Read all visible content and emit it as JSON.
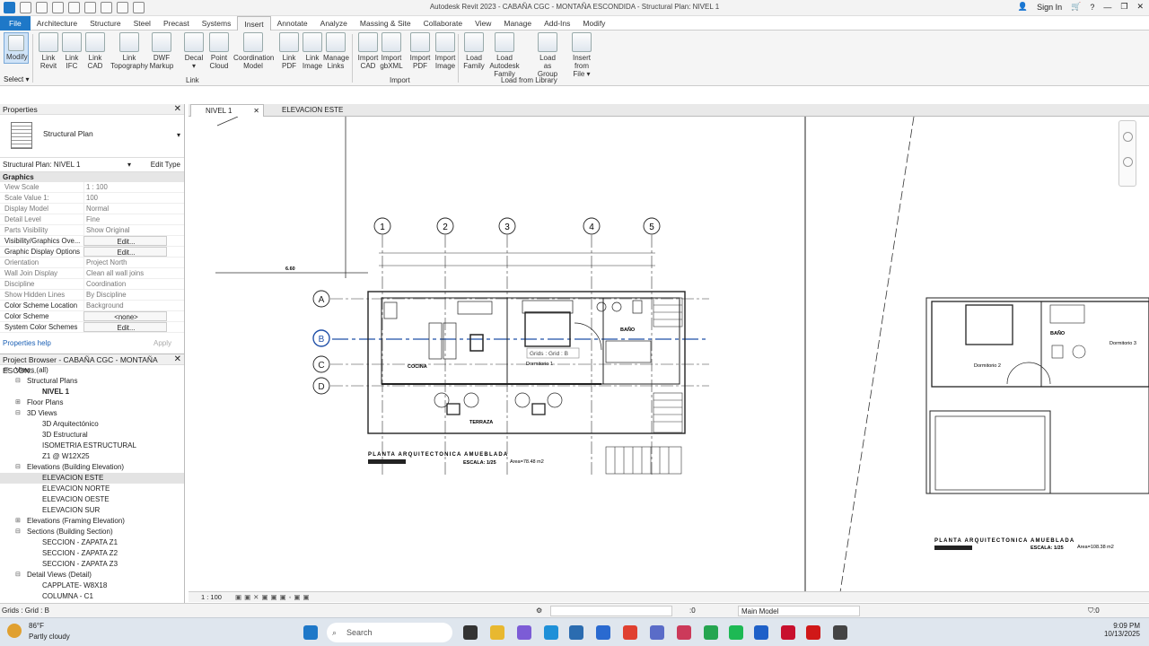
{
  "title_bar": {
    "title": "Autodesk Revit 2023 - CABAÑA CGC - MONTAÑA ESCONDIDA - Structural Plan: NIVEL 1",
    "sign_in": "Sign In"
  },
  "ribbon_tabs": [
    "File",
    "Architecture",
    "Structure",
    "Steel",
    "Precast",
    "Systems",
    "Insert",
    "Annotate",
    "Analyze",
    "Massing & Site",
    "Collaborate",
    "View",
    "Manage",
    "Add-Ins",
    "Modify"
  ],
  "ribbon": {
    "modify": "Modify",
    "select": "Select ▾",
    "buttons": [
      {
        "l1": "Link",
        "l2": "Revit"
      },
      {
        "l1": "Link",
        "l2": "IFC"
      },
      {
        "l1": "Link",
        "l2": "CAD"
      },
      {
        "l1": "Link",
        "l2": "Topography"
      },
      {
        "l1": "DWF",
        "l2": "Markup"
      },
      {
        "l1": "Decal",
        "l2": "▾"
      },
      {
        "l1": "Point",
        "l2": "Cloud"
      },
      {
        "l1": "Coordination",
        "l2": "Model"
      },
      {
        "l1": "Link",
        "l2": "PDF"
      },
      {
        "l1": "Link",
        "l2": "Image"
      },
      {
        "l1": "Manage",
        "l2": "Links"
      },
      {
        "l1": "Import",
        "l2": "CAD"
      },
      {
        "l1": "Import",
        "l2": "gbXML"
      },
      {
        "l1": "Import",
        "l2": "PDF"
      },
      {
        "l1": "Import",
        "l2": "Image"
      },
      {
        "l1": "Load",
        "l2": "Family"
      },
      {
        "l1": "Load Autodesk",
        "l2": "Family"
      },
      {
        "l1": "Load as",
        "l2": "Group"
      },
      {
        "l1": "Insert",
        "l2": "from File ▾"
      }
    ],
    "panels": [
      "Link",
      "Import",
      "Load from Library"
    ]
  },
  "properties": {
    "header": "Properties",
    "type_name": "Structural Plan",
    "instance": "Structural Plan: NIVEL 1",
    "edit_type": "Edit Type",
    "group": "Graphics",
    "rows": [
      {
        "k": "View Scale",
        "v": "1 : 100",
        "btn": false,
        "dark": false
      },
      {
        "k": "Scale Value    1:",
        "v": "100",
        "btn": false,
        "dark": false
      },
      {
        "k": "Display Model",
        "v": "Normal",
        "btn": false,
        "dark": false
      },
      {
        "k": "Detail Level",
        "v": "Fine",
        "btn": false,
        "dark": false
      },
      {
        "k": "Parts Visibility",
        "v": "Show Original",
        "btn": false,
        "dark": false
      },
      {
        "k": "Visibility/Graphics Ove...",
        "v": "Edit...",
        "btn": true,
        "dark": true
      },
      {
        "k": "Graphic Display Options",
        "v": "Edit...",
        "btn": true,
        "dark": true
      },
      {
        "k": "Orientation",
        "v": "Project North",
        "btn": false,
        "dark": false
      },
      {
        "k": "Wall Join Display",
        "v": "Clean all wall joins",
        "btn": false,
        "dark": false
      },
      {
        "k": "Discipline",
        "v": "Coordination",
        "btn": false,
        "dark": false
      },
      {
        "k": "Show Hidden Lines",
        "v": "By Discipline",
        "btn": false,
        "dark": false
      },
      {
        "k": "Color Scheme Location",
        "v": "Background",
        "btn": false,
        "dark": true
      },
      {
        "k": "Color Scheme",
        "v": "<none>",
        "btn": true,
        "dark": true
      },
      {
        "k": "System Color Schemes",
        "v": "Edit...",
        "btn": true,
        "dark": true
      }
    ],
    "help": "Properties help",
    "apply": "Apply"
  },
  "browser": {
    "header": "Project Browser - CABAÑA CGC - MONTAÑA ESCON...",
    "items": [
      {
        "t": "⊟",
        "label": "Views (all)",
        "lvl": 0,
        "sel": false,
        "bold": false
      },
      {
        "t": "⊟",
        "label": "Structural Plans",
        "lvl": 1,
        "sel": false,
        "bold": false
      },
      {
        "t": "",
        "label": "NIVEL 1",
        "lvl": 2,
        "sel": false,
        "bold": true
      },
      {
        "t": "⊞",
        "label": "Floor Plans",
        "lvl": 1,
        "sel": false,
        "bold": false
      },
      {
        "t": "⊟",
        "label": "3D Views",
        "lvl": 1,
        "sel": false,
        "bold": false
      },
      {
        "t": "",
        "label": "3D Arquitectónico",
        "lvl": 2,
        "sel": false,
        "bold": false
      },
      {
        "t": "",
        "label": "3D Estructural",
        "lvl": 2,
        "sel": false,
        "bold": false
      },
      {
        "t": "",
        "label": "ISOMETRIA ESTRUCTURAL",
        "lvl": 2,
        "sel": false,
        "bold": false
      },
      {
        "t": "",
        "label": "Z1 @ W12X25",
        "lvl": 2,
        "sel": false,
        "bold": false
      },
      {
        "t": "⊟",
        "label": "Elevations (Building Elevation)",
        "lvl": 1,
        "sel": false,
        "bold": false
      },
      {
        "t": "",
        "label": "ELEVACION ESTE",
        "lvl": 2,
        "sel": true,
        "bold": false
      },
      {
        "t": "",
        "label": "ELEVACION NORTE",
        "lvl": 2,
        "sel": false,
        "bold": false
      },
      {
        "t": "",
        "label": "ELEVACION OESTE",
        "lvl": 2,
        "sel": false,
        "bold": false
      },
      {
        "t": "",
        "label": "ELEVACION SUR",
        "lvl": 2,
        "sel": false,
        "bold": false
      },
      {
        "t": "⊞",
        "label": "Elevations (Framing Elevation)",
        "lvl": 1,
        "sel": false,
        "bold": false
      },
      {
        "t": "⊟",
        "label": "Sections (Building Section)",
        "lvl": 1,
        "sel": false,
        "bold": false
      },
      {
        "t": "",
        "label": "SECCION - ZAPATA Z1",
        "lvl": 2,
        "sel": false,
        "bold": false
      },
      {
        "t": "",
        "label": "SECCION - ZAPATA Z2",
        "lvl": 2,
        "sel": false,
        "bold": false
      },
      {
        "t": "",
        "label": "SECCION - ZAPATA Z3",
        "lvl": 2,
        "sel": false,
        "bold": false
      },
      {
        "t": "⊟",
        "label": "Detail Views (Detail)",
        "lvl": 1,
        "sel": false,
        "bold": false
      },
      {
        "t": "",
        "label": "CAPPLATE- W8X18",
        "lvl": 2,
        "sel": false,
        "bold": false
      },
      {
        "t": "",
        "label": "COLUMNA - C1",
        "lvl": 2,
        "sel": false,
        "bold": false
      }
    ]
  },
  "view_tabs": [
    {
      "label": "NIVEL 1"
    },
    {
      "label": "ELEVACION ESTE"
    }
  ],
  "drawing": {
    "grid_cols": [
      "1",
      "2",
      "3",
      "4",
      "5"
    ],
    "grid_rows": [
      "A",
      "B",
      "C",
      "D"
    ],
    "rooms": [
      "COCINA",
      "Dormitorio 1",
      "BAÑO",
      "TERRAZA"
    ],
    "rooms_right": [
      "BAÑO",
      "Dormitorio 2",
      "Dormitorio 3"
    ],
    "tooltip": "Grids : Grid : B",
    "title_left": "PLANTA ARQUITECTONICA AMUEBLADA",
    "scale_left": "ESCALA: 1/25",
    "area_left": "Area=78.48 m2",
    "title_right": "PLANTA ARQUITECTONICA AMUEBLADA",
    "scale_right": "ESCALA: 1/25",
    "area_right": "Area=108.38 m2",
    "dim_top": "6.60"
  },
  "view_control": {
    "scale": "1 : 100"
  },
  "status": {
    "text": "Grids : Grid : B",
    "workset": "Main Model",
    "sel_count": ":0"
  },
  "taskbar": {
    "temp": "86°F",
    "weather": "Partly cloudy",
    "search": "Search",
    "time": "9:09 PM",
    "date": "10/13/2025"
  },
  "colors": {
    "accent": "#1e78c8",
    "grid_selected": "#1f4fa8"
  }
}
